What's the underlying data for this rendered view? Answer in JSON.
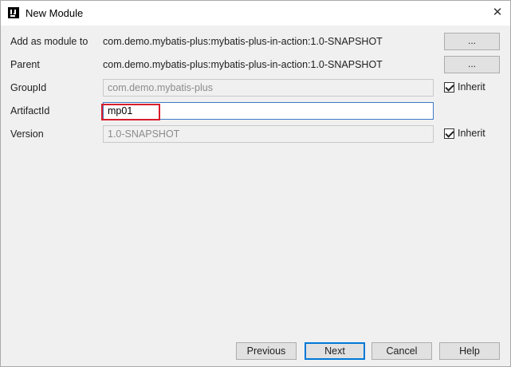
{
  "window": {
    "title": "New Module"
  },
  "form": {
    "add_as_module": {
      "label": "Add as module to",
      "value": "com.demo.mybatis-plus:mybatis-plus-in-action:1.0-SNAPSHOT",
      "button_label": "..."
    },
    "parent": {
      "label": "Parent",
      "value": "com.demo.mybatis-plus:mybatis-plus-in-action:1.0-SNAPSHOT",
      "button_label": "..."
    },
    "group_id": {
      "label": "GroupId",
      "value": "com.demo.mybatis-plus",
      "inherit_label": "Inherit",
      "inherit_checked": true
    },
    "artifact_id": {
      "label": "ArtifactId",
      "value": "mp01"
    },
    "version": {
      "label": "Version",
      "value": "1.0-SNAPSHOT",
      "inherit_label": "Inherit",
      "inherit_checked": true
    }
  },
  "footer": {
    "previous_label": "Previous",
    "next_label": "Next",
    "cancel_label": "Cancel",
    "help_label": "Help"
  },
  "colors": {
    "highlight_border": "#d81e2a",
    "focus_border": "#3d7ac7",
    "default_button_border": "#0078d7"
  }
}
